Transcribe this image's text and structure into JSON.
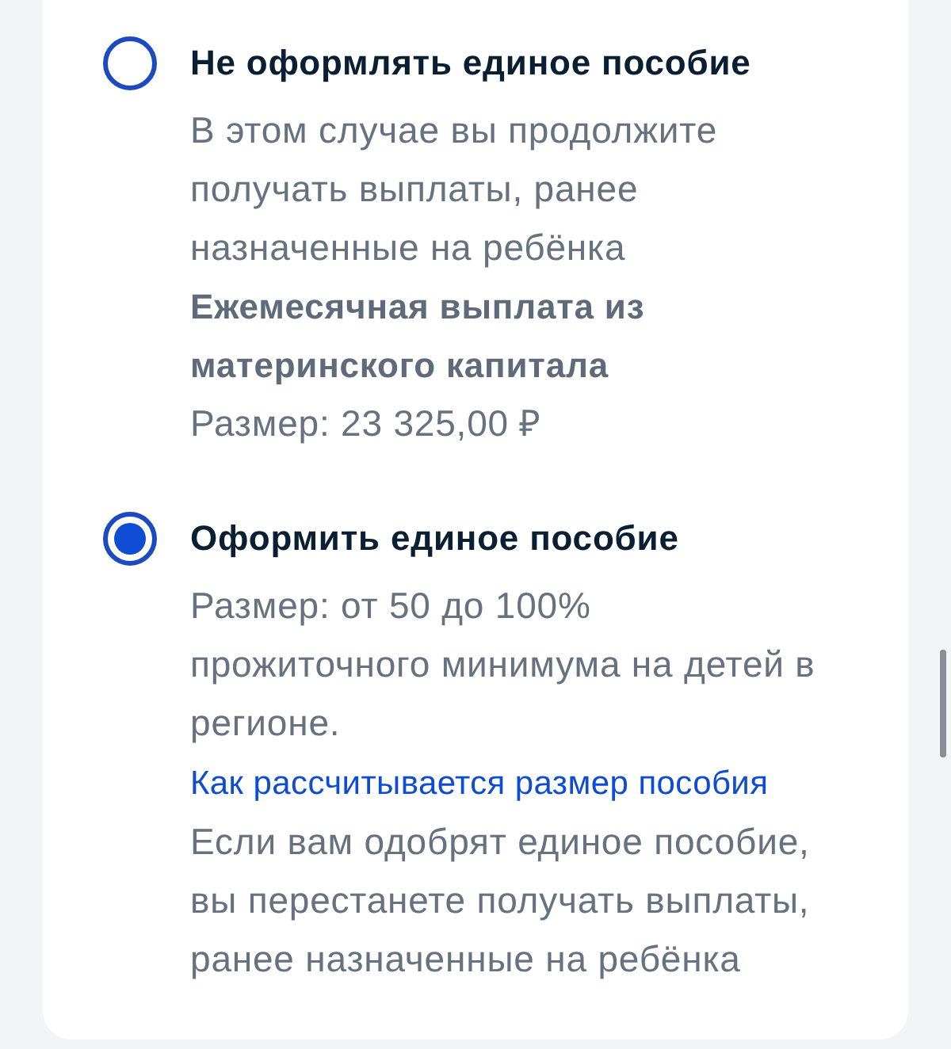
{
  "options": [
    {
      "title": "Не оформлять единое пособие",
      "selected": false,
      "details": [
        {
          "kind": "text",
          "text": "В этом случае вы продолжите получать выплаты, ранее назначенные на ребёнка"
        },
        {
          "kind": "strong",
          "text": "Ежемесячная выплата из материнского капитала"
        },
        {
          "kind": "text",
          "text": "Размер: 23 325,00 ₽"
        }
      ]
    },
    {
      "title": "Оформить единое пособие",
      "selected": true,
      "details": [
        {
          "kind": "text",
          "text": "Размер: от 50 до 100% прожиточного минимума на детей в регионе.",
          "link": "Как рассчитывается размер пособия"
        },
        {
          "kind": "text",
          "text": "Если вам одобрят единое пособие, вы перестанете получать выплаты, ранее назначенные на ребёнка"
        }
      ]
    }
  ]
}
